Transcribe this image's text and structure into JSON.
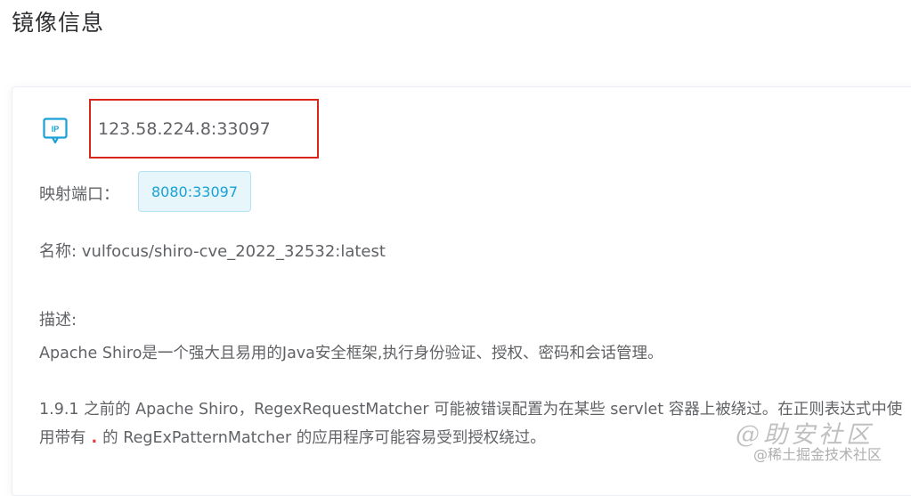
{
  "page": {
    "title": "镜像信息"
  },
  "image_info": {
    "ip_icon_text": "IP",
    "ip_address": "123.58.224.8:33097",
    "port_label": "映射端口：",
    "port_value": "8080:33097",
    "name_line": "名称: vulfocus/shiro-cve_2022_32532:latest",
    "description_label": "描述:",
    "description_p1": "Apache Shiro是一个强大且易用的Java安全框架,执行身份验证、授权、密码和会话管理。",
    "description_p2_before": "1.9.1 之前的 Apache Shiro，RegexRequestMatcher 可能被错误配置为在某些 servlet 容器上被绕过。在正则表达式中使用带有",
    "description_p2_dot": ".",
    "description_p2_after": "的 RegExPatternMatcher 的应用程序可能容易受到授权绕过。"
  },
  "watermark": {
    "top": "@助安社区",
    "bottom": "@稀土掘金技术社区"
  },
  "colors": {
    "highlight_border": "#d9261c",
    "tag_text": "#1aa0d6",
    "tag_bg": "#e6f6fb",
    "icon": "#1aa0d6"
  }
}
